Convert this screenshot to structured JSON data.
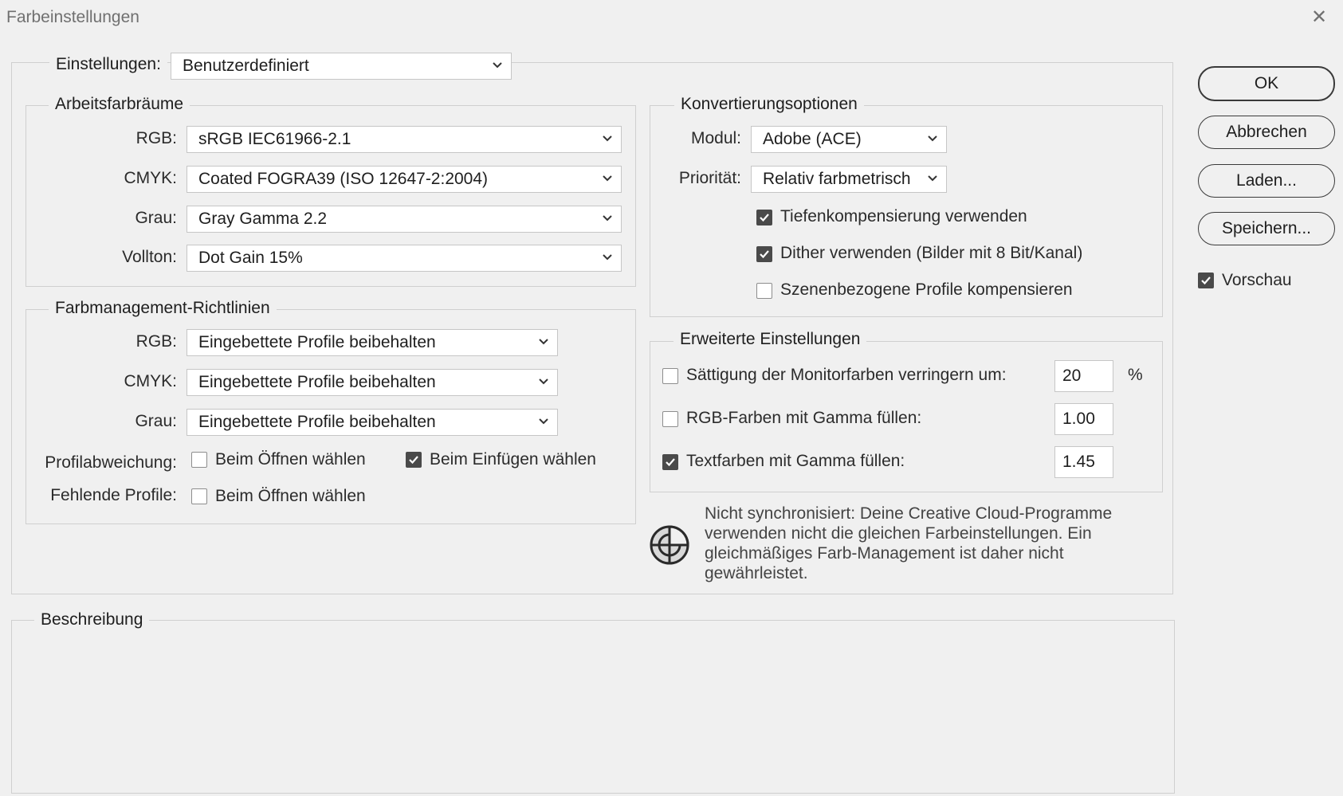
{
  "window": {
    "title": "Farbeinstellungen",
    "close_glyph": "✕"
  },
  "settings": {
    "label": "Einstellungen:",
    "value": "Benutzerdefiniert"
  },
  "workspaces": {
    "legend": "Arbeitsfarbräume",
    "rows": [
      {
        "label": "RGB:",
        "value": "sRGB IEC61966-2.1"
      },
      {
        "label": "CMYK:",
        "value": "Coated FOGRA39 (ISO 12647-2:2004)"
      },
      {
        "label": "Grau:",
        "value": "Gray Gamma 2.2"
      },
      {
        "label": "Vollton:",
        "value": "Dot Gain 15%"
      }
    ]
  },
  "policies": {
    "legend": "Farbmanagement-Richtlinien",
    "rows": [
      {
        "label": "RGB:",
        "value": "Eingebettete Profile beibehalten"
      },
      {
        "label": "CMYK:",
        "value": "Eingebettete Profile beibehalten"
      },
      {
        "label": "Grau:",
        "value": "Eingebettete Profile beibehalten"
      }
    ],
    "mismatch_label": "Profilabweichung:",
    "mismatch_open": {
      "label": "Beim Öffnen wählen",
      "checked": false
    },
    "mismatch_paste": {
      "label": "Beim Einfügen wählen",
      "checked": true
    },
    "missing_label": "Fehlende Profile:",
    "missing_open": {
      "label": "Beim Öffnen wählen",
      "checked": false
    }
  },
  "conversion": {
    "legend": "Konvertierungsoptionen",
    "engine_label": "Modul:",
    "engine_value": "Adobe (ACE)",
    "intent_label": "Priorität:",
    "intent_value": "Relativ farbmetrisch",
    "blackpoint": {
      "label": "Tiefenkompensierung verwenden",
      "checked": true
    },
    "dither": {
      "label": "Dither verwenden (Bilder mit 8 Bit/Kanal)",
      "checked": true
    },
    "scene": {
      "label": "Szenenbezogene Profile kompensieren",
      "checked": false
    }
  },
  "advanced": {
    "legend": "Erweiterte Einstellungen",
    "desaturate": {
      "label": "Sättigung der Monitorfarben verringern um:",
      "checked": false,
      "value": "20",
      "unit": "%"
    },
    "blend_rgb": {
      "label": "RGB-Farben mit Gamma füllen:",
      "checked": false,
      "value": "1.00"
    },
    "blend_text": {
      "label": "Textfarben mit Gamma füllen:",
      "checked": true,
      "value": "1.45"
    }
  },
  "sync": {
    "icon": "sync-status-icon",
    "lines": [
      "Nicht synchronisiert: Deine Creative Cloud-Programme",
      "verwenden nicht die gleichen Farbeinstellungen. Ein",
      "gleichmäßiges Farb-Management ist daher nicht",
      "gewährleistet."
    ]
  },
  "description": {
    "legend": "Beschreibung"
  },
  "buttons": {
    "ok": "OK",
    "cancel": "Abbrechen",
    "load": "Laden...",
    "save": "Speichern..."
  },
  "preview": {
    "label": "Vorschau",
    "checked": true
  }
}
